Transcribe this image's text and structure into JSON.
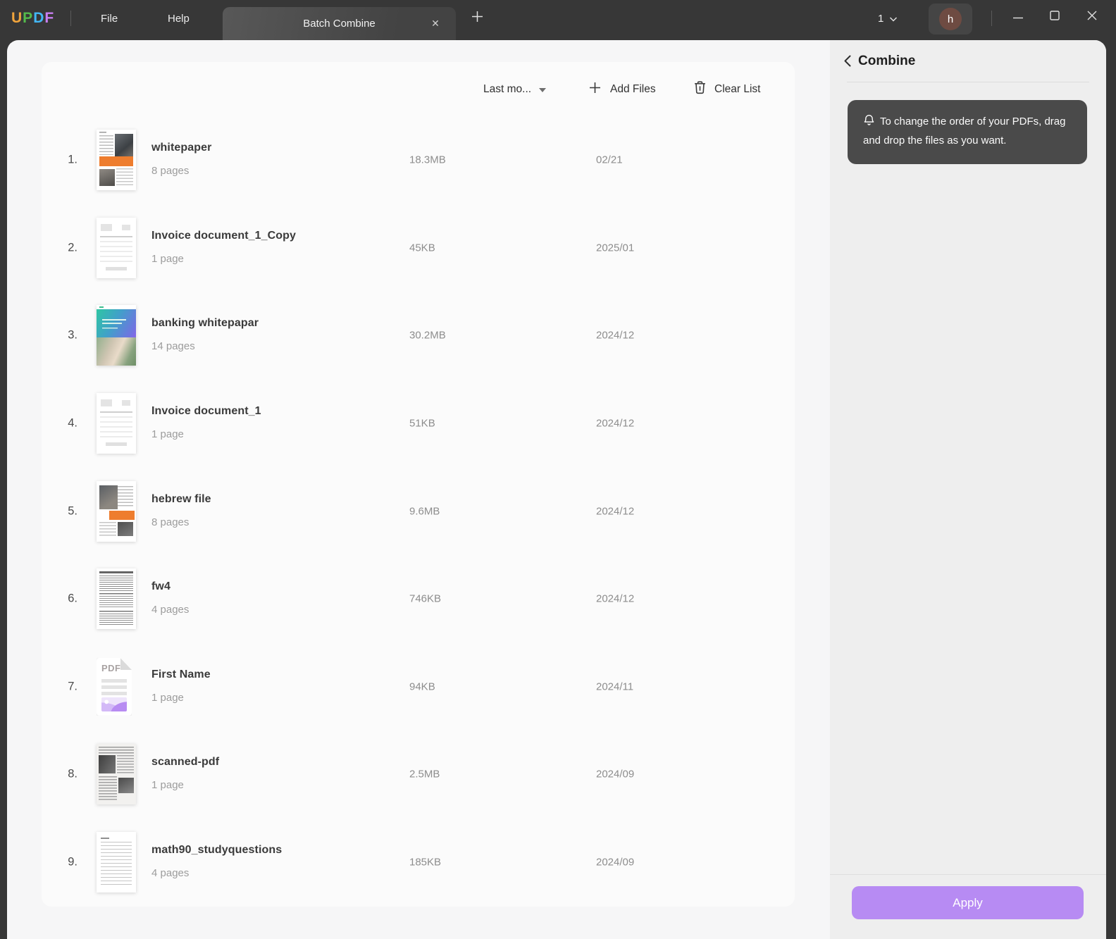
{
  "titlebar": {
    "logo": [
      {
        "letter": "U",
        "color": "#F0A43C"
      },
      {
        "letter": "P",
        "color": "#54BA4B"
      },
      {
        "letter": "D",
        "color": "#43B7F5"
      },
      {
        "letter": "F",
        "color": "#C97FF3"
      }
    ],
    "menu_file": "File",
    "menu_help": "Help",
    "tab_label": "Batch Combine",
    "tab_close": "✕",
    "window_count": "1",
    "avatar_initial": "h"
  },
  "toolbar": {
    "sort_label": "Last mo...",
    "add_files": "Add Files",
    "clear_list": "Clear List"
  },
  "files": {
    "list": [
      {
        "index": "1.",
        "name": "whitepaper",
        "pages": "8 pages",
        "size": "18.3MB",
        "date": "02/21",
        "thumb": "article-orange"
      },
      {
        "index": "2.",
        "name": "Invoice document_1_Copy",
        "pages": "1 page",
        "size": "45KB",
        "date": "2025/01",
        "thumb": "invoice"
      },
      {
        "index": "3.",
        "name": "banking whitepapar",
        "pages": "14 pages",
        "size": "30.2MB",
        "date": "2024/12",
        "thumb": "cover-gradient"
      },
      {
        "index": "4.",
        "name": "Invoice document_1",
        "pages": "1 page",
        "size": "51KB",
        "date": "2024/12",
        "thumb": "invoice"
      },
      {
        "index": "5.",
        "name": "hebrew file",
        "pages": "8 pages",
        "size": "9.6MB",
        "date": "2024/12",
        "thumb": "article-photo"
      },
      {
        "index": "6.",
        "name": "fw4",
        "pages": "4 pages",
        "size": "746KB",
        "date": "2024/12",
        "thumb": "form"
      },
      {
        "index": "7.",
        "name": "First Name",
        "pages": "1 page",
        "size": "94KB",
        "date": "2024/11",
        "thumb": "pdf-icon",
        "thumb_label": "PDF"
      },
      {
        "index": "8.",
        "name": "scanned-pdf",
        "pages": "1 page",
        "size": "2.5MB",
        "date": "2024/09",
        "thumb": "scan"
      },
      {
        "index": "9.",
        "name": "math90_studyquestions",
        "pages": "4 pages",
        "size": "185KB",
        "date": "2024/09",
        "thumb": "text-page"
      }
    ]
  },
  "side_panel": {
    "title": "Combine",
    "tip": "To change the order of your PDFs, drag and drop the files as you want.",
    "apply": "Apply"
  },
  "colors": {
    "accent": "#B78BF3",
    "tooltip_bg": "#4A4A4A",
    "titlebar_bg": "#373737"
  }
}
